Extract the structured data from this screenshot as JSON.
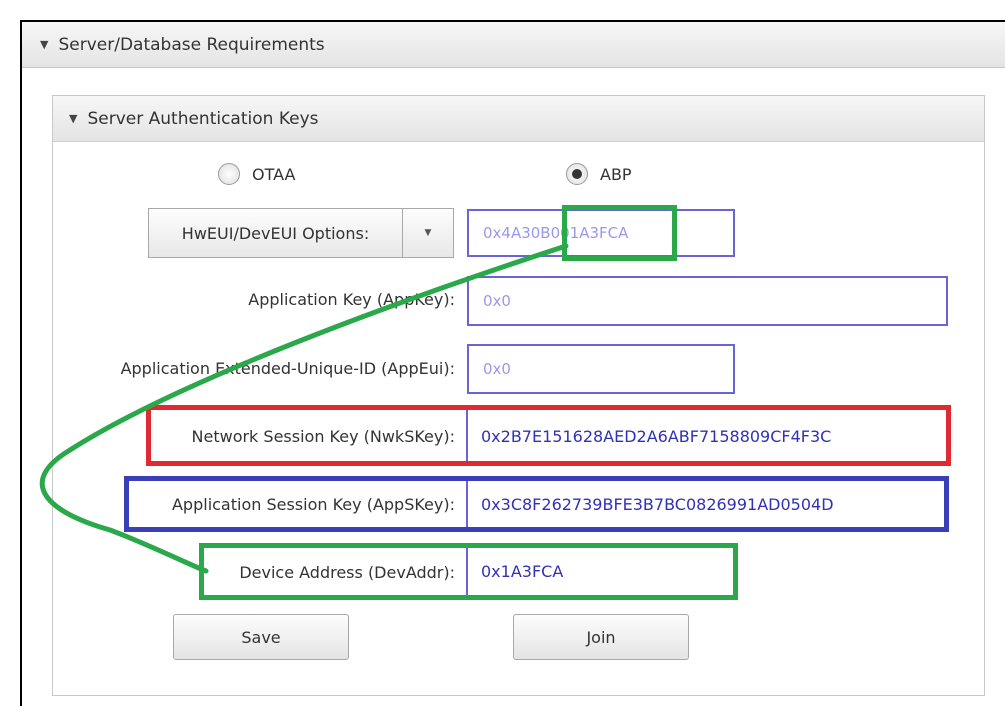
{
  "outer_section": {
    "title": "Server/Database Requirements"
  },
  "inner_section": {
    "title": "Server Authentication Keys"
  },
  "activation": {
    "options": [
      {
        "label": "OTAA",
        "selected": false
      },
      {
        "label": "ABP",
        "selected": true
      }
    ]
  },
  "hweui": {
    "dropdown_label": "HwEUI/DevEUI Options:",
    "value": "0x4A30B001A3FCA"
  },
  "fields": {
    "app_key": {
      "label": "Application Key (AppKey):",
      "value": "0x0"
    },
    "app_eui": {
      "label": "Application Extended-Unique-ID (AppEui):",
      "value": "0x0"
    },
    "nwk_skey": {
      "label": "Network Session Key (NwkSKey):",
      "value": "0x2B7E151628AED2A6ABF7158809CF4F3C"
    },
    "app_skey": {
      "label": "Application Session Key (AppSKey):",
      "value": "0x3C8F262739BFE3B7BC0826991AD0504D"
    },
    "dev_addr": {
      "label": "Device Address (DevAddr):",
      "value": "0x1A3FCA"
    }
  },
  "buttons": {
    "save": "Save",
    "join": "Join"
  },
  "colors": {
    "highlight_red": "#e02a32",
    "highlight_blue": "#3a3fb6",
    "highlight_green": "#2aa84a",
    "field_border": "#6a64d6",
    "field_text": "#3230b8"
  }
}
